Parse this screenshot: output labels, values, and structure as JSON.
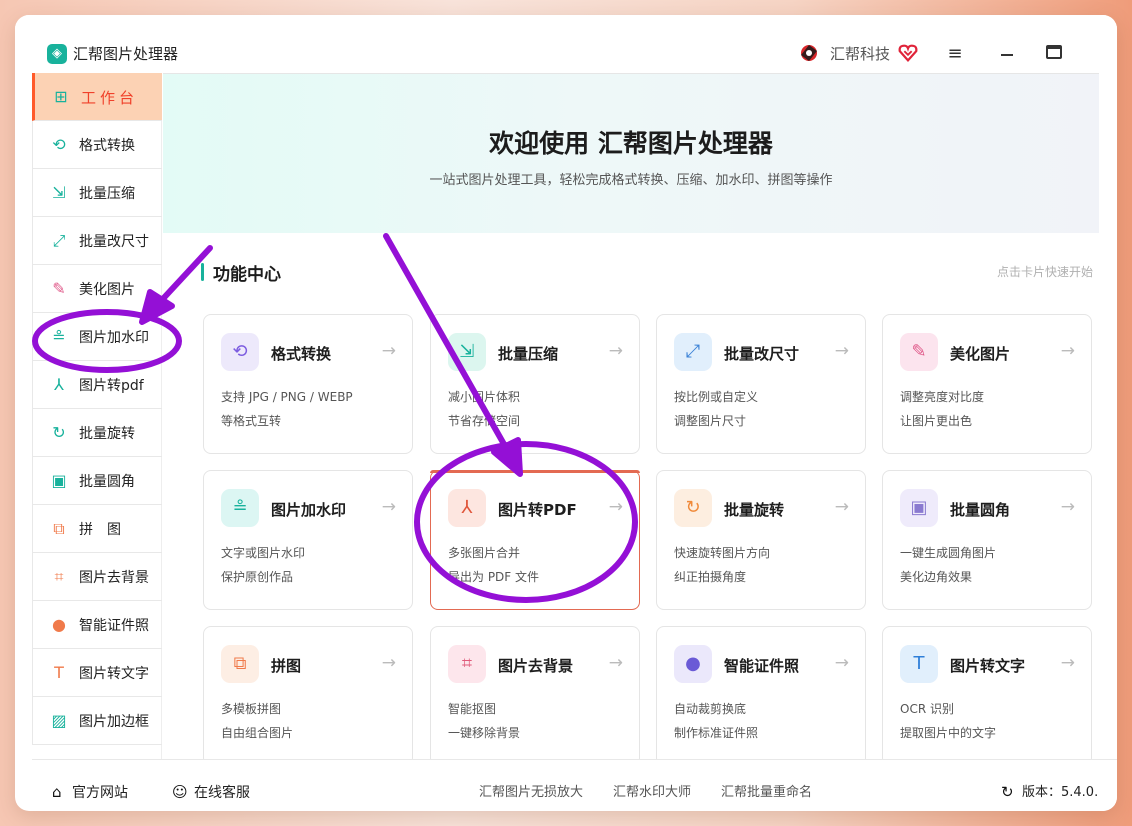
{
  "app": {
    "title": "汇帮图片处理器",
    "logo_icon": "app-logo-icon"
  },
  "titlebar": {
    "brand": "汇帮科技"
  },
  "sidebar": {
    "items": [
      {
        "label": "工作台",
        "icon": "⊞",
        "color": "#18b29c"
      },
      {
        "label": "格式转换",
        "icon": "⟲",
        "color": "#18b29c"
      },
      {
        "label": "批量压缩",
        "icon": "⇲",
        "color": "#18b29c"
      },
      {
        "label": "批量改尺寸",
        "icon": "⤢",
        "color": "#18b29c"
      },
      {
        "label": "美化图片",
        "icon": "✎",
        "color": "#e05a8a"
      },
      {
        "label": "图片加水印",
        "icon": "≗",
        "color": "#18b29c"
      },
      {
        "label": "图片转pdf",
        "icon": "⅄",
        "color": "#18b29c"
      },
      {
        "label": "批量旋转",
        "icon": "↻",
        "color": "#18b29c"
      },
      {
        "label": "批量圆角",
        "icon": "▣",
        "color": "#18b29c"
      },
      {
        "label": "拼　图",
        "icon": "⧉",
        "color": "#f07a4a"
      },
      {
        "label": "图片去背景",
        "icon": "⌗",
        "color": "#f07a4a"
      },
      {
        "label": "智能证件照",
        "icon": "●",
        "color": "#f07a4a"
      },
      {
        "label": "图片转文字",
        "icon": "T",
        "color": "#f07a4a"
      },
      {
        "label": "图片加边框",
        "icon": "▨",
        "color": "#18b29c"
      }
    ]
  },
  "banner": {
    "title": "欢迎使用 汇帮图片处理器",
    "subtitle": "一站式图片处理工具，轻松完成格式转换、压缩、加水印、拼图等操作"
  },
  "section": {
    "title": "功能中心",
    "hint": "点击卡片快速开始"
  },
  "cards": [
    {
      "title": "格式转换",
      "d1": "支持 JPG / PNG / WEBP",
      "d2": "等格式互转",
      "icon": "⟲",
      "bg": "#ede9fb",
      "fg": "#7c5ce0"
    },
    {
      "title": "批量压缩",
      "d1": "减小图片体积",
      "d2": "节省存储空间",
      "icon": "⇲",
      "bg": "#dcf6ef",
      "fg": "#18b29c"
    },
    {
      "title": "批量改尺寸",
      "d1": "按比例或自定义",
      "d2": "调整图片尺寸",
      "icon": "⤢",
      "bg": "#e1effc",
      "fg": "#3b82d6"
    },
    {
      "title": "美化图片",
      "d1": "调整亮度对比度",
      "d2": "让图片更出色",
      "icon": "✎",
      "bg": "#fce4ee",
      "fg": "#e05a8a"
    },
    {
      "title": "图片加水印",
      "d1": "文字或图片水印",
      "d2": "保护原创作品",
      "icon": "≗",
      "bg": "#dcf6f3",
      "fg": "#18b29c"
    },
    {
      "title": "图片转PDF",
      "d1": "多张图片合并",
      "d2": "导出为 PDF 文件",
      "icon": "⅄",
      "bg": "#fde6e0",
      "fg": "#e0553a"
    },
    {
      "title": "批量旋转",
      "d1": "快速旋转图片方向",
      "d2": "纠正拍摄角度",
      "icon": "↻",
      "bg": "#fdeee0",
      "fg": "#f08a3a"
    },
    {
      "title": "批量圆角",
      "d1": "一键生成圆角图片",
      "d2": "美化边角效果",
      "icon": "▣",
      "bg": "#efebfb",
      "fg": "#8a7ad0"
    },
    {
      "title": "拼图",
      "d1": "多模板拼图",
      "d2": "自由组合图片",
      "icon": "⧉",
      "bg": "#fdeee4",
      "fg": "#f07a4a"
    },
    {
      "title": "图片去背景",
      "d1": "智能抠图",
      "d2": "一键移除背景",
      "icon": "⌗",
      "bg": "#fde6ec",
      "fg": "#e05a7a"
    },
    {
      "title": "智能证件照",
      "d1": "自动裁剪换底",
      "d2": "制作标准证件照",
      "icon": "●",
      "bg": "#ebe8fb",
      "fg": "#6a5ad6"
    },
    {
      "title": "图片转文字",
      "d1": "OCR 识别",
      "d2": "提取图片中的文字",
      "icon": "T",
      "bg": "#e1effc",
      "fg": "#2f7fd8"
    }
  ],
  "card_arrow": "→",
  "footer": {
    "official_site": "官方网站",
    "online_service": "在线客服",
    "links": [
      "汇帮图片无损放大",
      "汇帮水印大师",
      "汇帮批量重命名"
    ],
    "version": "版本：5.4.0."
  },
  "annotation_color": "#9410d6"
}
